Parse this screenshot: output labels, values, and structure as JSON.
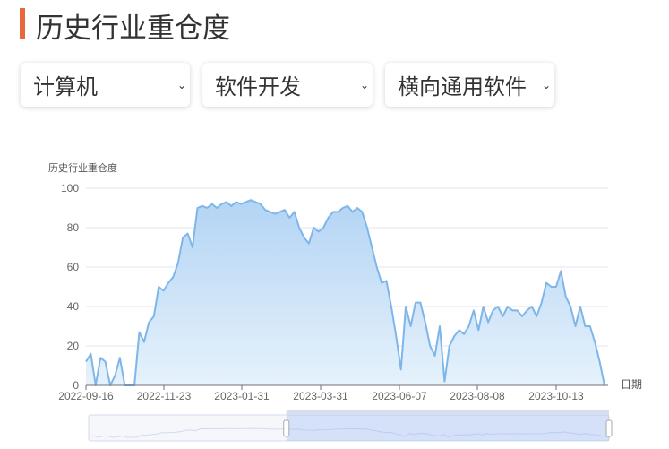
{
  "page_title": "历史行业重仓度",
  "filters": [
    {
      "value": "计算机"
    },
    {
      "value": "软件开发"
    },
    {
      "value": "横向通用软件"
    }
  ],
  "colors": {
    "accent": "#e8673c",
    "line": "#7eb6ea",
    "fill_top": "#b3d4f4",
    "fill_bottom": "#e6f2fc"
  },
  "chart_data": {
    "type": "area",
    "ylabel": "历史行业重仓度",
    "xlabel": "日期",
    "ylim": [
      0,
      100
    ],
    "yticks": [
      "0",
      "20",
      "40",
      "60",
      "80",
      "100"
    ],
    "xticks": [
      "2022-09-16",
      "2022-11-23",
      "2023-01-31",
      "2023-03-31",
      "2023-06-07",
      "2023-08-08",
      "2023-10-13"
    ],
    "grid": true,
    "values": [
      12,
      16,
      0,
      14,
      12,
      0,
      5,
      14,
      0,
      0,
      0,
      27,
      22,
      32,
      35,
      50,
      48,
      52,
      55,
      62,
      75,
      77,
      70,
      90,
      91,
      90,
      92,
      90,
      92,
      93,
      91,
      93,
      92,
      93,
      94,
      93,
      92,
      89,
      88,
      87,
      88,
      89,
      85,
      88,
      80,
      75,
      72,
      80,
      78,
      80,
      85,
      88,
      88,
      90,
      91,
      88,
      90,
      88,
      80,
      70,
      60,
      52,
      53,
      40,
      25,
      8,
      40,
      30,
      42,
      42,
      32,
      20,
      15,
      30,
      2,
      20,
      25,
      28,
      26,
      30,
      38,
      28,
      40,
      32,
      38,
      40,
      35,
      40,
      38,
      38,
      35,
      38,
      40,
      35,
      42,
      52,
      50,
      50,
      58,
      45,
      40,
      30,
      40,
      30,
      30,
      22,
      12,
      0
    ],
    "datazoom": {
      "start_percent": 38,
      "end_percent": 100
    }
  }
}
